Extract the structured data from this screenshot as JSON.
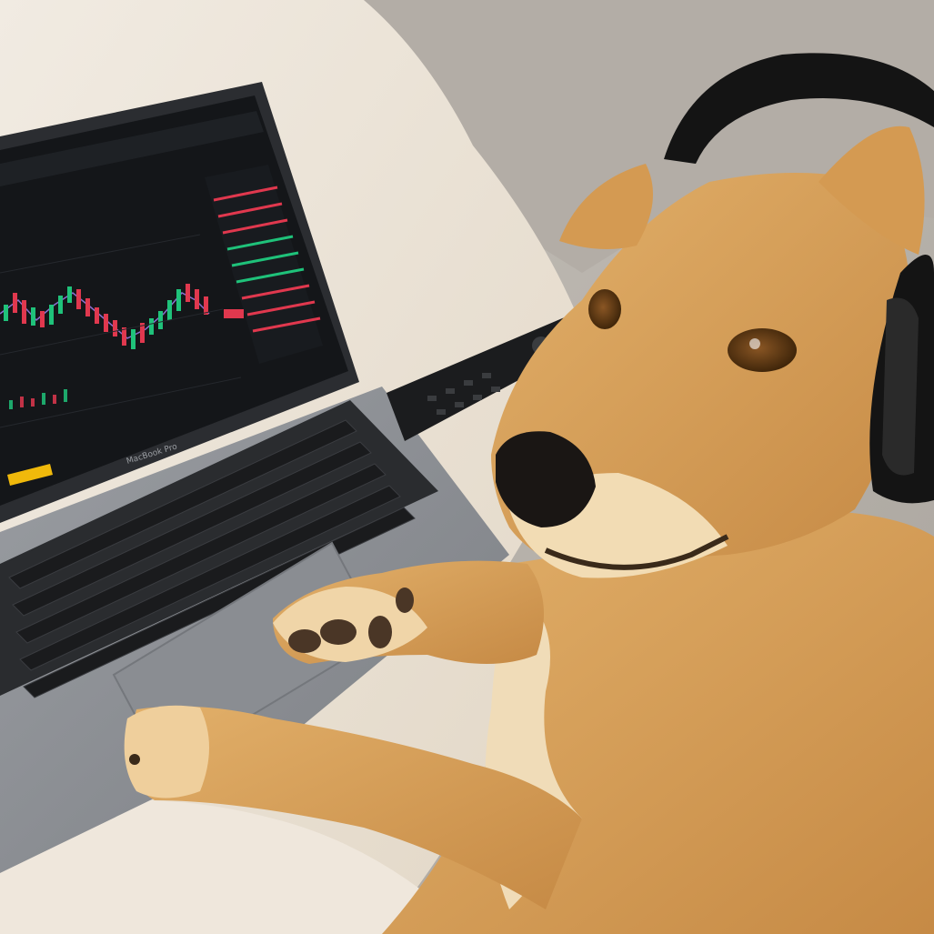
{
  "scene": {
    "subject": "dog",
    "colors": {
      "dog_fur": "#d8a35c",
      "dog_fur_light": "#efcf9c",
      "headphones": "#141414",
      "laptop_body": "#8e9196",
      "screen_bg": "#141619",
      "candle_up": "#1fc27a",
      "candle_down": "#e0384e",
      "blanket": "#eee6da",
      "sofa": "#b7b2ac"
    }
  },
  "laptop": {
    "brand_label": "MacBook Pro"
  }
}
